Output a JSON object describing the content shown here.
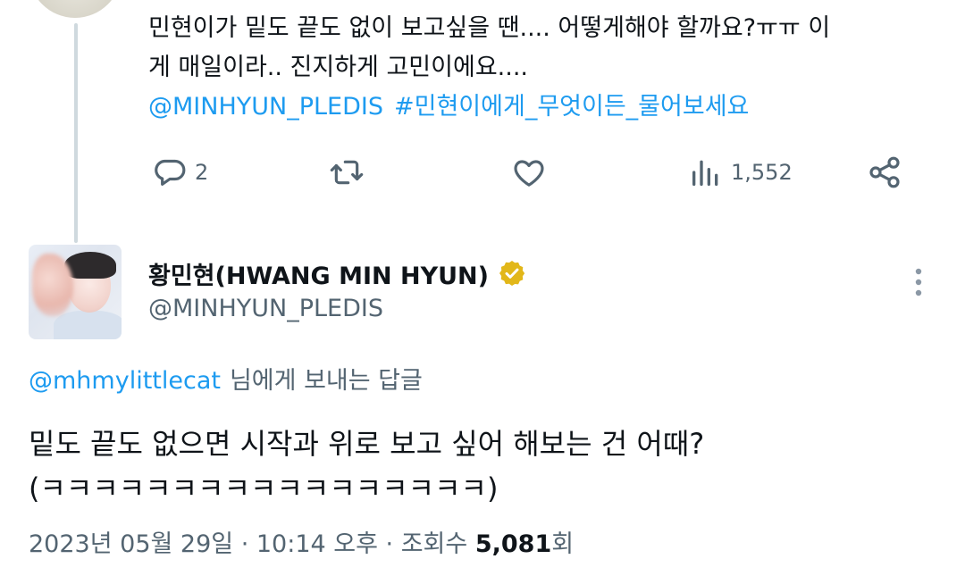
{
  "previous_tweet": {
    "text_line1": "민현이가 밑도 끝도 없이 보고싶을 땐.... 어떻게해야 할까요?ㅠㅠ 이",
    "text_line2": "게 매일이라.. 진지하게 고민이에요....",
    "mention": "@MINHYUN_PLEDIS",
    "hashtag": "#민현이에게_무엇이든_물어보세요",
    "actions": {
      "reply_count": "2",
      "retweet_count": "",
      "like_count": "",
      "views_count": "1,552"
    }
  },
  "main_tweet": {
    "display_name": "황민현(HWANG MIN HYUN)",
    "handle": "@MINHYUN_PLEDIS",
    "reply_to_handle": "@mhmylittlecat",
    "reply_to_suffix": "님에게 보내는 답글",
    "text_line1": "밑도 끝도 없으면 시작과 위로 보고 싶어 해보는 건 어때?",
    "text_line2": "(ㅋㅋㅋㅋㅋㅋㅋㅋㅋㅋㅋㅋㅋㅋㅋㅋㅋ)",
    "meta": {
      "date": "2023년 05월 29일",
      "time": "10:14 오후",
      "views_label": "조회수",
      "views_count": "5,081",
      "views_suffix": "회"
    }
  },
  "icons": [
    "reply-icon",
    "retweet-icon",
    "like-icon",
    "views-icon",
    "share-icon",
    "verified-badge-icon",
    "more-icon"
  ],
  "colors": {
    "link": "#1d9bf0",
    "muted": "#536471",
    "text": "#0f1419",
    "verified": "#e2b719",
    "thread_line": "#cfd9de"
  }
}
